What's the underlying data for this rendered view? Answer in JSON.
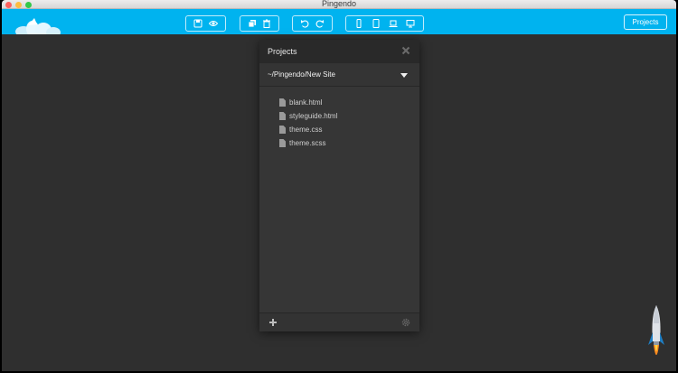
{
  "window": {
    "title": "Pingendo"
  },
  "toolbar": {
    "groups": [
      {
        "icons": [
          "save-icon",
          "preview-eye-icon"
        ]
      },
      {
        "icons": [
          "duplicate-icon",
          "trash-icon"
        ]
      },
      {
        "icons": [
          "undo-icon",
          "redo-icon"
        ]
      },
      {
        "icons": [
          "phone-icon",
          "tablet-icon",
          "laptop-icon",
          "desktop-icon"
        ]
      }
    ],
    "projects_label": "Projects",
    "accent_color": "#00b3ef"
  },
  "projects_panel": {
    "title": "Projects",
    "path": "~/Pingendo/New Site",
    "files": [
      {
        "name": "blank.html"
      },
      {
        "name": "styleguide.html"
      },
      {
        "name": "theme.css"
      },
      {
        "name": "theme.scss"
      }
    ]
  }
}
